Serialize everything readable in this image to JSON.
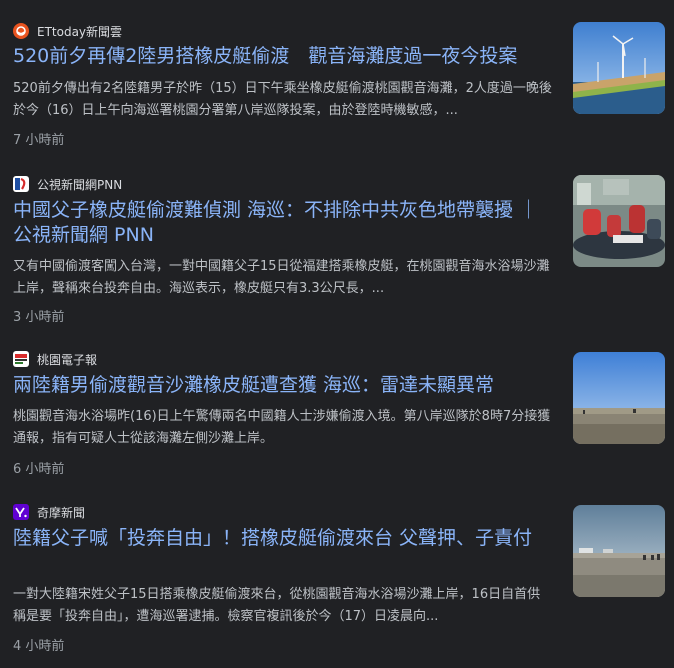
{
  "articles": [
    {
      "source": "ETtoday新聞雲",
      "source_icon": "ettoday-logo-icon",
      "title": "520前夕再傳2陸男搭橡皮艇偷渡　觀音海灘度過一夜今投案",
      "snippet": "520前夕傳出有2名陸籍男子於昨（15）日下午乘坐橡皮艇偷渡桃園觀音海灘，2人度過一晚後於今（16）日上午向海巡署桃園分署第八岸巡隊投案，由於登陸時機敏感，...",
      "time": "7 小時前",
      "thumbnail": "wind-turbine-coast-image"
    },
    {
      "source": "公視新聞網PNN",
      "source_icon": "pts-logo-icon",
      "title": "中國父子橡皮艇偷渡難偵測 海巡：不排除中共灰色地帶襲擾 ｜ 公視新聞網 PNN",
      "snippet": "又有中國偷渡客闖入台灣，一對中國籍父子15日從福建搭乘橡皮艇，在桃園觀音海水浴場沙灘上岸，聲稱來台投奔自由。海巡表示，橡皮艇只有3.3公尺長，...",
      "time": "3 小時前",
      "thumbnail": "rubber-boat-people-image"
    },
    {
      "source": "桃園電子報",
      "source_icon": "taoyuan-epaper-logo-icon",
      "title": "兩陸籍男偷渡觀音沙灘橡皮艇遭查獲 海巡：雷達未顯異常",
      "snippet": "桃園觀音海水浴場昨(16)日上午驚傳兩名中國籍人士涉嫌偷渡入境。第八岸巡隊於8時7分接獲通報，指有可疑人士從該海灘左側沙灘上岸。",
      "time": "6 小時前",
      "thumbnail": "beach-sky-image"
    },
    {
      "source": "奇摩新聞",
      "source_icon": "yahoo-logo-icon",
      "title": "陸籍父子喊「投奔自由」！搭橡皮艇偷渡來台 父聲押、子責付",
      "snippet": "一對大陸籍宋姓父子15日搭乘橡皮艇偷渡來台，從桃園觀音海水浴場沙灘上岸，16日自首供稱是要「投奔自由」，遭海巡署逮捕。檢察官複訊後於今（17）日凌晨向...",
      "time": "4 小時前",
      "thumbnail": "beach-gray-image"
    }
  ],
  "colors": {
    "background": "#202124",
    "title_link": "#8ab4f8",
    "snippet": "#bdc1c6",
    "meta": "#9aa0a6"
  }
}
